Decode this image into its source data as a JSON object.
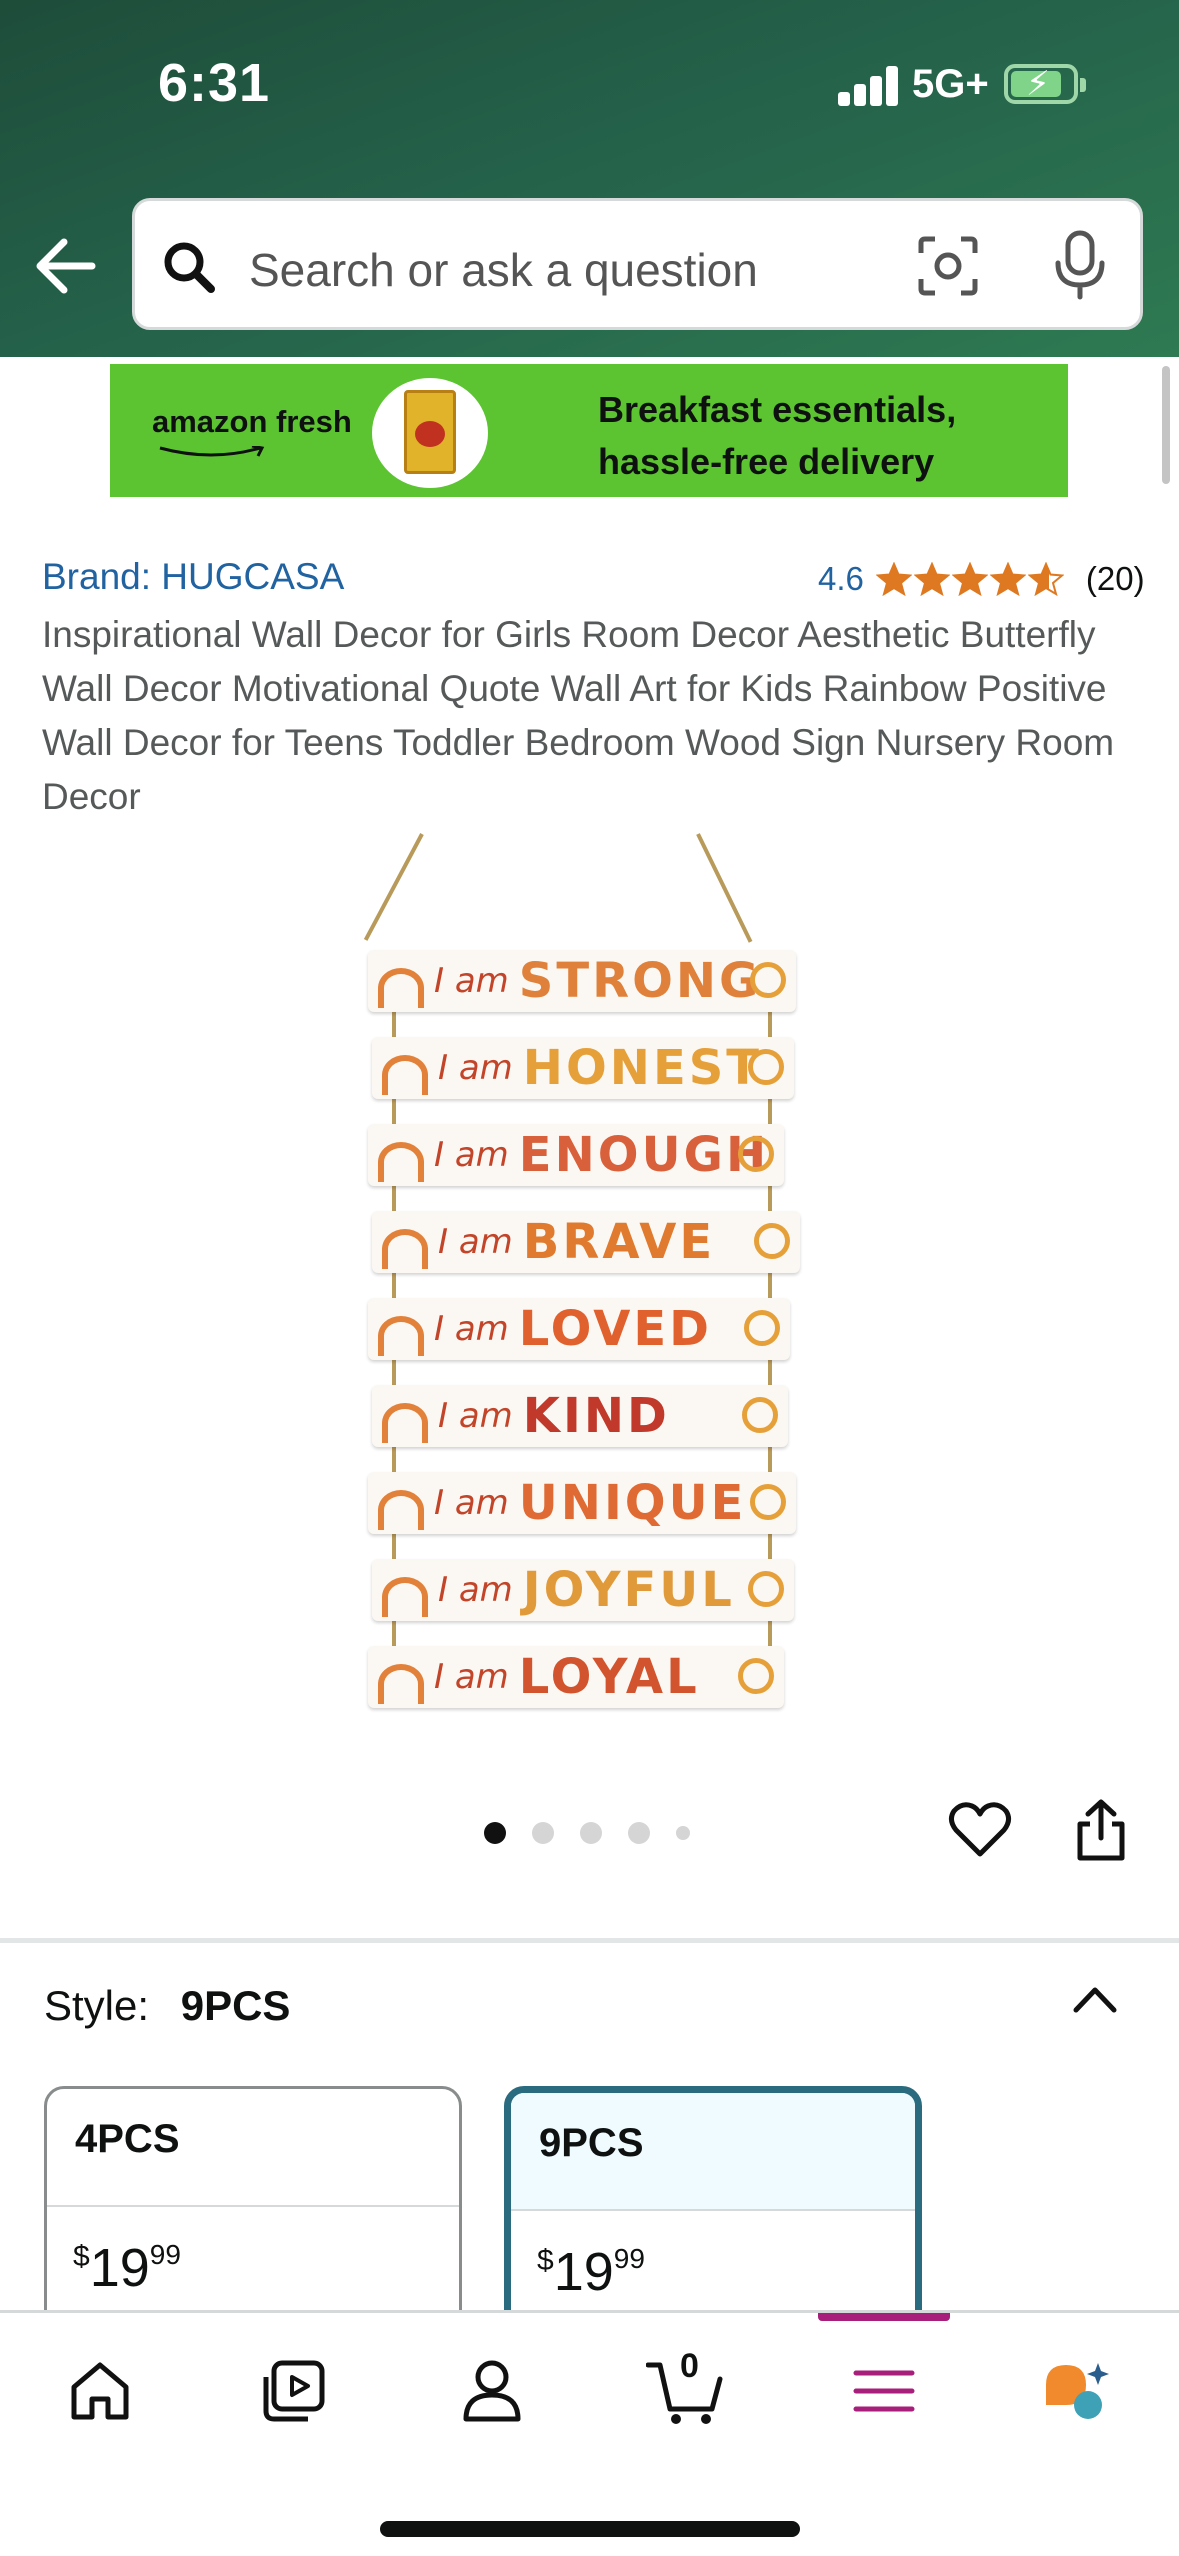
{
  "status_bar": {
    "time": "6:31",
    "network": "5G+"
  },
  "search": {
    "placeholder": "Search or ask a question"
  },
  "banner": {
    "logo_text": "amazon fresh",
    "line1": "Breakfast essentials,",
    "line2": "hassle-free delivery"
  },
  "product": {
    "brand": "Brand: HUGCASA",
    "rating": "4.6",
    "rating_value": 4.6,
    "review_count": "(20)",
    "title": "Inspirational Wall Decor for Girls Room Decor Aesthetic Butterfly Wall Decor Motivational Quote Wall Art for Kids Rainbow Positive Wall Decor for Teens Toddler Bedroom Wood Sign Nursery Room Decor",
    "image": {
      "prefix": "I am",
      "words": [
        "STRONG",
        "HONEST",
        "ENOUGH",
        "BRAVE",
        "LOVED",
        "KIND",
        "UNIQUE",
        "JOYFUL",
        "LOYAL"
      ]
    },
    "image_count": 5,
    "active_image_index": 0
  },
  "style": {
    "label": "Style:",
    "selected": "9PCS",
    "options": [
      {
        "name": "4PCS",
        "currency": "$",
        "price_whole": "19",
        "price_fraction": "99"
      },
      {
        "name": "9PCS",
        "currency": "$",
        "price_whole": "19",
        "price_fraction": "99"
      }
    ]
  },
  "bottom_nav": {
    "cart_count": "0",
    "active": "menu"
  },
  "colors": {
    "header_green": "#24614a",
    "banner_green": "#5cc431",
    "link_blue": "#2162a1",
    "star_orange": "#de7921",
    "selected_border": "#2a6b80",
    "menu_accent": "#a81e7b"
  },
  "icons": [
    "back-arrow-icon",
    "search-icon",
    "camera-lens-icon",
    "microphone-icon",
    "heart-icon",
    "share-icon",
    "chevron-up-icon",
    "home-icon",
    "video-icon",
    "account-icon",
    "cart-icon",
    "menu-icon",
    "rufus-chat-icon"
  ]
}
